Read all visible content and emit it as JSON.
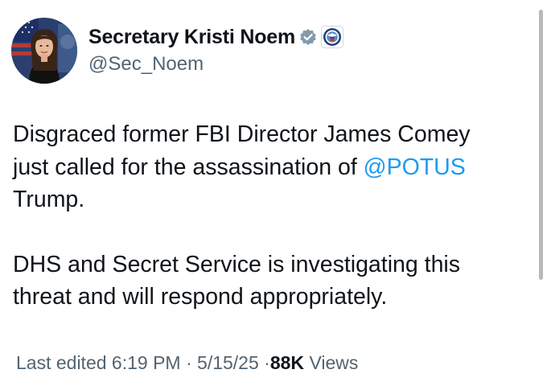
{
  "author": {
    "display_name": "Secretary Kristi Noem",
    "handle": "@Sec_Noem",
    "verified_badge_color": "#829aab",
    "badge_icon": "dhs-seal-icon"
  },
  "tweet": {
    "paragraph1_before": "Disgraced former FBI Director James Comey just called for the assassination of ",
    "mention": "@POTUS",
    "paragraph1_after": " Trump.",
    "paragraph2": "DHS and Secret Service is investigating this threat and will respond appropriately."
  },
  "meta": {
    "edited_prefix": "Last edited",
    "time": "6:19 PM",
    "separator": "·",
    "date": "5/15/25",
    "views_count": "88K",
    "views_label": "Views"
  },
  "colors": {
    "mention": "#1d9bf0",
    "secondary_text": "#536471",
    "primary_text": "#0f1419"
  }
}
